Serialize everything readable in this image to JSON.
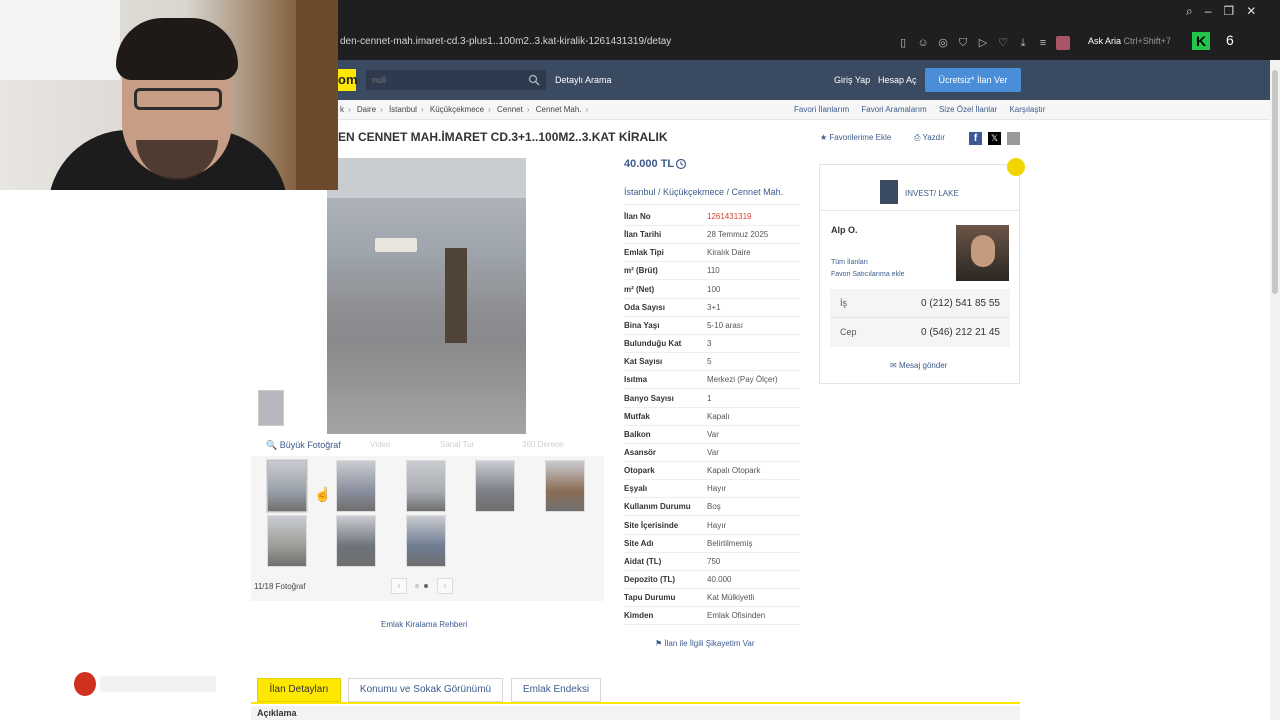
{
  "browser": {
    "url": "den-cennet-mah.imaret-cd.3-plus1..100m2..3.kat-kiralik-1261431319/detay",
    "ask_aria_label": "Ask Aria",
    "ask_aria_shortcut": "Ctrl+Shift+7",
    "tab_count": "6"
  },
  "header": {
    "logo_text": "om",
    "search_placeholder": "null",
    "detailed_search": "Detaylı Arama",
    "login": "Giriş Yap",
    "register": "Hesap Aç",
    "post_ad": "Ücretsiz* İlan Ver"
  },
  "breadcrumb": {
    "items": [
      "k",
      "Daire",
      "İstanbul",
      "Küçükçekmece",
      "Cennet",
      "Cennet Mah."
    ],
    "right_links": [
      "Favori İlanlarım",
      "Favori Aramalarım",
      "Size Özel İlanlar",
      "Karşılaştır"
    ]
  },
  "listing": {
    "title": "EN CENNET MAH.İMARET CD.3+1..100M2..3.KAT KİRALIK",
    "add_favorite": "Favorilerime Ekle",
    "print": "Yazdır",
    "price": "40.000 TL",
    "location": "İstanbul  /  Küçükçekmece  /  Cennet Mah.",
    "attributes": [
      {
        "key": "İlan No",
        "value": "1261431319",
        "highlight": true
      },
      {
        "key": "İlan Tarihi",
        "value": "28 Temmuz 2025"
      },
      {
        "key": "Emlak Tipi",
        "value": "Kiralık Daire"
      },
      {
        "key": "m² (Brüt)",
        "value": "110"
      },
      {
        "key": "m² (Net)",
        "value": "100"
      },
      {
        "key": "Oda Sayısı",
        "value": "3+1"
      },
      {
        "key": "Bina Yaşı",
        "value": "5-10 arası"
      },
      {
        "key": "Bulunduğu Kat",
        "value": "3"
      },
      {
        "key": "Kat Sayısı",
        "value": "5"
      },
      {
        "key": "Isıtma",
        "value": "Merkezi (Pay Ölçer)"
      },
      {
        "key": "Banyo Sayısı",
        "value": "1"
      },
      {
        "key": "Mutfak",
        "value": "Kapalı"
      },
      {
        "key": "Balkon",
        "value": "Var"
      },
      {
        "key": "Asansör",
        "value": "Var"
      },
      {
        "key": "Otopark",
        "value": "Kapalı Otopark"
      },
      {
        "key": "Eşyalı",
        "value": "Hayır"
      },
      {
        "key": "Kullanım Durumu",
        "value": "Boş"
      },
      {
        "key": "Site İçerisinde",
        "value": "Hayır"
      },
      {
        "key": "Site Adı",
        "value": "Belirtilmemiş"
      },
      {
        "key": "Aidat (TL)",
        "value": "750"
      },
      {
        "key": "Depozito (TL)",
        "value": "40.000"
      },
      {
        "key": "Tapu Durumu",
        "value": "Kat Mülkiyetli"
      },
      {
        "key": "Kimden",
        "value": "Emlak Ofisinden"
      }
    ],
    "complaint": "İlan ile İlgili Şikayetim Var"
  },
  "gallery": {
    "big_photo": "Büyük Fotoğraf",
    "faded_actions": [
      "Video",
      "Sanal Tur",
      "360 Derece"
    ],
    "photo_count": "11/18 Fotoğraf",
    "thumb_colors": [
      "#9aa1aa",
      "#8a8f9e",
      "#a9adb3",
      "#7c7f86",
      "#8b6d55",
      "#9d9c98",
      "#6e727a",
      "#6f7d92"
    ],
    "rent_guide": "Emlak Kiralama Rehberi"
  },
  "seller": {
    "store_name": "INVEST/ LAKE",
    "agent_name": "Alp O.",
    "all_listings": "Tüm İlanları",
    "add_favorite_seller": "Favori Satıcılarıma ekle",
    "phones": [
      {
        "label": "İş",
        "number": "0 (212) 541 85 55"
      },
      {
        "label": "Cep",
        "number": "0 (546) 212 21 45"
      }
    ],
    "send_message": "Mesaj gönder"
  },
  "tabs": {
    "items": [
      "İlan Detayları",
      "Konumu ve Sokak Görünümü",
      "Emlak Endeksi"
    ],
    "section_title": "Açıklama"
  },
  "colors": {
    "header_bg": "#3a4a61",
    "accent_yellow": "#ffe800",
    "link_blue": "#3d5c8c",
    "post_button": "#4b8ed8",
    "listing_no_red": "#d0442f"
  }
}
